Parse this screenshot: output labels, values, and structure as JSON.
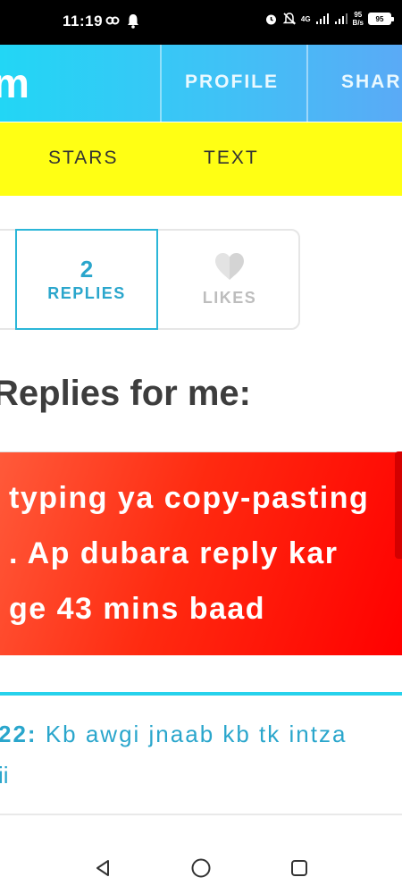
{
  "status_bar": {
    "time": "11:19",
    "network_speed": "95",
    "network_speed_unit": "B/s",
    "network_type": "4G",
    "battery": "95"
  },
  "app": {
    "logo_text": "m",
    "tabs": [
      {
        "label": "PROFILE"
      },
      {
        "label": "SHAR"
      }
    ]
  },
  "subnav": {
    "items": [
      {
        "label": "STARS"
      },
      {
        "label": "TEXT"
      }
    ]
  },
  "stats": {
    "replies_count": "2",
    "replies_label": "REPLIES",
    "likes_label": "LIKES"
  },
  "section": {
    "title": "Replies for me:"
  },
  "alert": {
    "lines": [
      "typing ya copy-pasting",
      ". Ap dubara reply kar",
      "ge 43 mins baad"
    ]
  },
  "reply": {
    "number": "22:",
    "text": "Kb awgi jnaab kb tk intza",
    "text_line2": "ii"
  },
  "colors": {
    "header_start": "#22d6f5",
    "header_end": "#5aaaf6",
    "subnav_bg": "#ffff14",
    "accent": "#2aa6cc",
    "alert_red": "#ff0000"
  }
}
